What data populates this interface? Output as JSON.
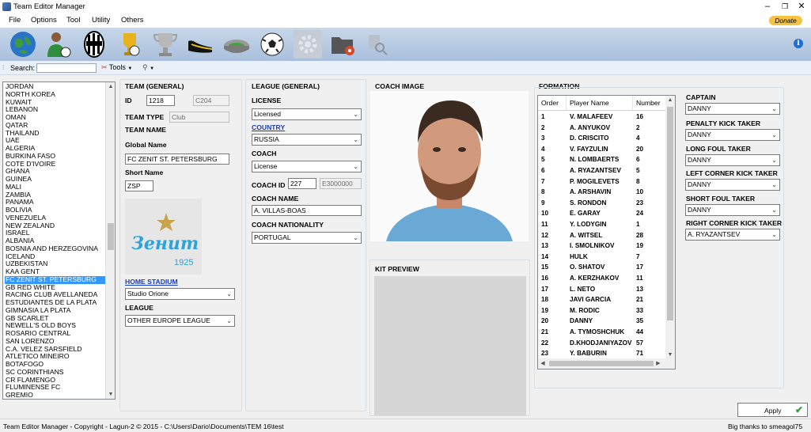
{
  "window": {
    "title": "Team Editor Manager",
    "controls": [
      "–",
      "❐",
      "✕"
    ]
  },
  "menu": {
    "items": [
      "File",
      "Options",
      "Tool",
      "Utility",
      "Others"
    ],
    "donate": "Donate"
  },
  "toolbar": {
    "icons": [
      "globe-icon",
      "player-icon",
      "team-crest-icon",
      "trophy-gold-icon",
      "trophy-silver-icon",
      "boot-icon",
      "stadium-icon",
      "ball-icon",
      "settings-gear-icon",
      "folder-settings-icon",
      "search-tools-icon"
    ],
    "info": "i"
  },
  "search": {
    "label": "Search:",
    "value": "",
    "tools_label": "Tools"
  },
  "country_list": {
    "items": [
      "JORDAN",
      "NORTH KOREA",
      "KUWAIT",
      "LEBANON",
      "OMAN",
      "QATAR",
      "THAILAND",
      "UAE",
      "ALGERIA",
      "BURKINA FASO",
      "COTE D'IVOIRE",
      "GHANA",
      "GUINEA",
      "MALI",
      "ZAMBIA",
      "PANAMA",
      "BOLIVIA",
      "VENEZUELA",
      "NEW ZEALAND",
      "ISRAEL",
      "ALBANIA",
      "BOSNIA AND HERZEGOVINA",
      "ICELAND",
      "UZBEKISTAN",
      "KAA GENT",
      "FC ZENIT ST. PETERSBURG",
      "GB RED WHITE",
      "RACING CLUB AVELLANEDA",
      "ESTUDIANTES DE LA PLATA",
      "GIMNASIA LA PLATA",
      "GB SCARLET",
      "NEWELL'S OLD BOYS",
      "ROSARIO CENTRAL",
      "SAN LORENZO",
      "C.A. VELEZ SARSFIELD",
      "ATLETICO MINEIRO",
      "BOTAFOGO",
      "SC CORINTHIANS",
      "CR FLAMENGO",
      "FLUMINENSE FC",
      "GREMIO"
    ],
    "selected_index": 25
  },
  "team_general": {
    "heading": "TEAM (GENERAL)",
    "id_label": "ID",
    "id_value": "1218",
    "id_code": "C204",
    "team_type_label": "TEAM TYPE",
    "team_type_value": "Club",
    "team_name_label": "TEAM NAME",
    "global_name_label": "Global Name",
    "global_name_value": "FC ZENIT ST. PETERSBURG",
    "short_name_label": "Short Name",
    "short_name_value": "ZSP",
    "logo_text": "Зенит",
    "logo_year": "1925",
    "home_stadium_label": "HOME STADIUM",
    "home_stadium_value": "Studio Orione",
    "league_label": "LEAGUE",
    "league_value": "OTHER EUROPE LEAGUE"
  },
  "league_general": {
    "heading": "LEAGUE (GENERAL)",
    "license_label": "LICENSE",
    "license_value": "Licensed",
    "country_label": "COUNTRY",
    "country_value": "RUSSIA",
    "coach_label": "COACH",
    "coach_value": "License",
    "coach_id_label": "COACH ID",
    "coach_id_value": "227",
    "coach_id_code": "E3000000",
    "coach_name_label": "COACH NAME",
    "coach_name_value": "A. VILLAS-BOAS",
    "coach_nationality_label": "COACH NATIONALITY",
    "coach_nationality_value": "PORTUGAL"
  },
  "coach_image": {
    "heading": "COACH IMAGE"
  },
  "kit_preview": {
    "heading": "KIT PREVIEW"
  },
  "formation": {
    "heading": "FORMATION",
    "columns": [
      "Order",
      "Player Name",
      "Number"
    ],
    "rows": [
      [
        "1",
        "V. MALAFEEV",
        "16"
      ],
      [
        "2",
        "A. ANYUKOV",
        "2"
      ],
      [
        "3",
        "D. CRISCITO",
        "4"
      ],
      [
        "4",
        "V. FAYZULIN",
        "20"
      ],
      [
        "5",
        "N. LOMBAERTS",
        "6"
      ],
      [
        "6",
        "A. RYAZANTSEV",
        "5"
      ],
      [
        "7",
        "P. MOGILEVETS",
        "8"
      ],
      [
        "8",
        "A. ARSHAVIN",
        "10"
      ],
      [
        "9",
        "S. RONDON",
        "23"
      ],
      [
        "10",
        "E. GARAY",
        "24"
      ],
      [
        "11",
        "Y. LODYGIN",
        "1"
      ],
      [
        "12",
        "A. WITSEL",
        "28"
      ],
      [
        "13",
        "I. SMOLNIKOV",
        "19"
      ],
      [
        "14",
        "HULK",
        "7"
      ],
      [
        "15",
        "O. SHATOV",
        "17"
      ],
      [
        "16",
        "A. KERZHAKOV",
        "11"
      ],
      [
        "17",
        "L. NETO",
        "13"
      ],
      [
        "18",
        "JAVI GARCIA",
        "21"
      ],
      [
        "19",
        "M. RODIC",
        "33"
      ],
      [
        "20",
        "DANNY",
        "35"
      ],
      [
        "21",
        "A. TYMOSHCHUK",
        "44"
      ],
      [
        "22",
        "D.KHODJANIYAZOV",
        "57"
      ],
      [
        "23",
        "Y. BABURIN",
        "71"
      ]
    ]
  },
  "roles": {
    "captain_label": "CAPTAIN",
    "captain_value": "DANNY",
    "penalty_label": "PENALTY KICK TAKER",
    "penalty_value": "DANNY",
    "long_foul_label": "LONG FOUL TAKER",
    "long_foul_value": "DANNY",
    "left_corner_label": "LEFT CORNER KICK TAKER",
    "left_corner_value": "DANNY",
    "short_foul_label": "SHORT FOUL TAKER",
    "short_foul_value": "DANNY",
    "right_corner_label": "RIGHT CORNER KICK TAKER",
    "right_corner_value": "A. RYAZANTSEV"
  },
  "apply_label": "Apply",
  "status": {
    "text": "Team Editor Manager - Copyright - Lagun-2 © 2015 -   C:\\Users\\Dario\\Documents\\TEM 16\\test",
    "thanks": "Big thanks to smeagol75"
  },
  "colors": {
    "selection": "#3399ff",
    "toolbar_top": "#c8d7ea",
    "toolbar_bottom": "#a9bfdb",
    "link": "#1a3cb5",
    "donate": "#f5c242",
    "zenit_blue": "#2aa3dd",
    "zenit_gold": "#c8a34a"
  }
}
